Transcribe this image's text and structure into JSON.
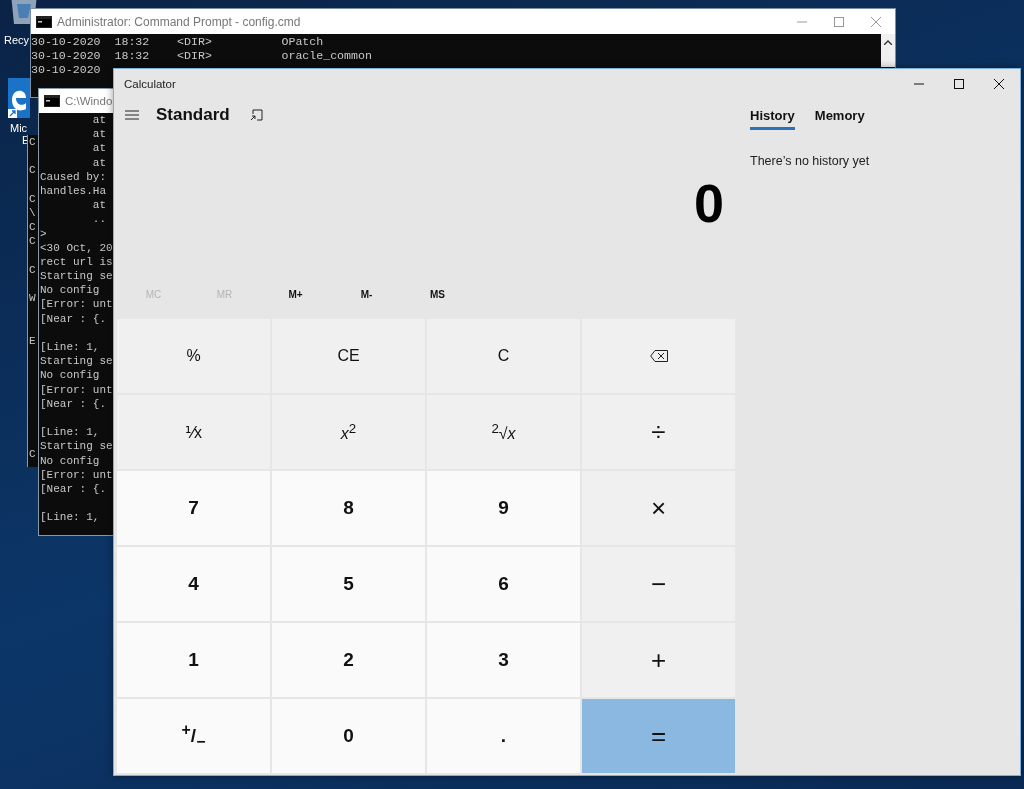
{
  "desktop_icons": [
    {
      "kind": "recycle",
      "label_lines": [
        "Recy"
      ]
    },
    {
      "kind": "edge",
      "label_lines": [
        "Mic",
        "E"
      ]
    }
  ],
  "console_top": {
    "title": "Administrator: Command Prompt - config.cmd",
    "lines": [
      {
        "text": "30-10-2020  18:32    <DIR>          OPatch"
      },
      {
        "text": "30-10-2020  18:32    <DIR>          oracle_common"
      },
      {
        "text": "30-10-2020"
      }
    ]
  },
  "console_middle": {
    "lines": [
      {
        "text": "C"
      },
      {
        "kind": "blank"
      },
      {
        "text": "C"
      },
      {
        "kind": "blank"
      },
      {
        "text": "C"
      },
      {
        "text": "\\"
      },
      {
        "text": "C"
      },
      {
        "text": "C"
      },
      {
        "kind": "blank"
      },
      {
        "text": "C"
      },
      {
        "kind": "blank"
      },
      {
        "text": "W"
      },
      {
        "kind": "blank"
      },
      {
        "kind": "blank"
      },
      {
        "text": "E"
      },
      {
        "kind": "blank"
      },
      {
        "kind": "blank"
      },
      {
        "kind": "blank"
      },
      {
        "kind": "blank"
      },
      {
        "kind": "blank"
      },
      {
        "kind": "blank"
      },
      {
        "kind": "blank"
      },
      {
        "text": "C"
      }
    ]
  },
  "console_front": {
    "title": "C:\\Windo",
    "lines": [
      {
        "text": "        at"
      },
      {
        "text": "        at"
      },
      {
        "text": "        at"
      },
      {
        "text": "        at"
      },
      {
        "text": "Caused by:"
      },
      {
        "text": "handles.Ha"
      },
      {
        "text": "        at"
      },
      {
        "text": "        .."
      },
      {
        "text": ">"
      },
      {
        "text": "<30 Oct, 20"
      },
      {
        "text": "rect url is"
      },
      {
        "text": "Starting se"
      },
      {
        "text": "No config"
      },
      {
        "text": "[Error: unt"
      },
      {
        "text": "[Near : {."
      },
      {
        "kind": "blank"
      },
      {
        "text": "[Line: 1,"
      },
      {
        "text": "Starting se"
      },
      {
        "text": "No config"
      },
      {
        "text": "[Error: unt"
      },
      {
        "text": "[Near : {."
      },
      {
        "kind": "blank"
      },
      {
        "text": "[Line: 1,"
      },
      {
        "text": "Starting se"
      },
      {
        "text": "No config"
      },
      {
        "text": "[Error: unt"
      },
      {
        "text": "[Near : {."
      },
      {
        "kind": "blank"
      },
      {
        "text": "[Line: 1,"
      }
    ]
  },
  "calculator": {
    "title": "Calculator",
    "mode": "Standard",
    "display": "0",
    "memory_buttons": [
      {
        "label": "MC",
        "disabled": true
      },
      {
        "label": "MR",
        "disabled": true
      },
      {
        "label": "M+",
        "disabled": false
      },
      {
        "label": "M-",
        "disabled": false
      },
      {
        "label": "MS",
        "disabled": false
      }
    ],
    "keys": [
      {
        "label": "%",
        "kind": "function"
      },
      {
        "label": "CE",
        "kind": "function"
      },
      {
        "label": "C",
        "kind": "function"
      },
      {
        "kind": "backspace"
      },
      {
        "label": "⅟x",
        "kind": "function"
      },
      {
        "label": "*x*$^{2}$",
        "kind": "function"
      },
      {
        "label": "$^{2}$√*x*",
        "kind": "function"
      },
      {
        "label": "÷",
        "kind": "operator"
      },
      {
        "label": "7",
        "kind": "digit"
      },
      {
        "label": "8",
        "kind": "digit"
      },
      {
        "label": "9",
        "kind": "digit"
      },
      {
        "label": "×",
        "kind": "operator"
      },
      {
        "label": "4",
        "kind": "digit"
      },
      {
        "label": "5",
        "kind": "digit"
      },
      {
        "label": "6",
        "kind": "digit"
      },
      {
        "label": "−",
        "kind": "operator"
      },
      {
        "label": "1",
        "kind": "digit"
      },
      {
        "label": "2",
        "kind": "digit"
      },
      {
        "label": "3",
        "kind": "digit"
      },
      {
        "label": "+",
        "kind": "operator"
      },
      {
        "label": "$^{+}$/$_{−}$",
        "kind": "digit"
      },
      {
        "label": "0",
        "kind": "digit"
      },
      {
        "label": ".",
        "kind": "digit"
      },
      {
        "label": "=",
        "kind": "equals"
      }
    ],
    "panel_tabs": [
      {
        "label": "History",
        "selected": true
      },
      {
        "label": "Memory",
        "selected": false
      }
    ],
    "panel_message": "There’s no history yet"
  }
}
